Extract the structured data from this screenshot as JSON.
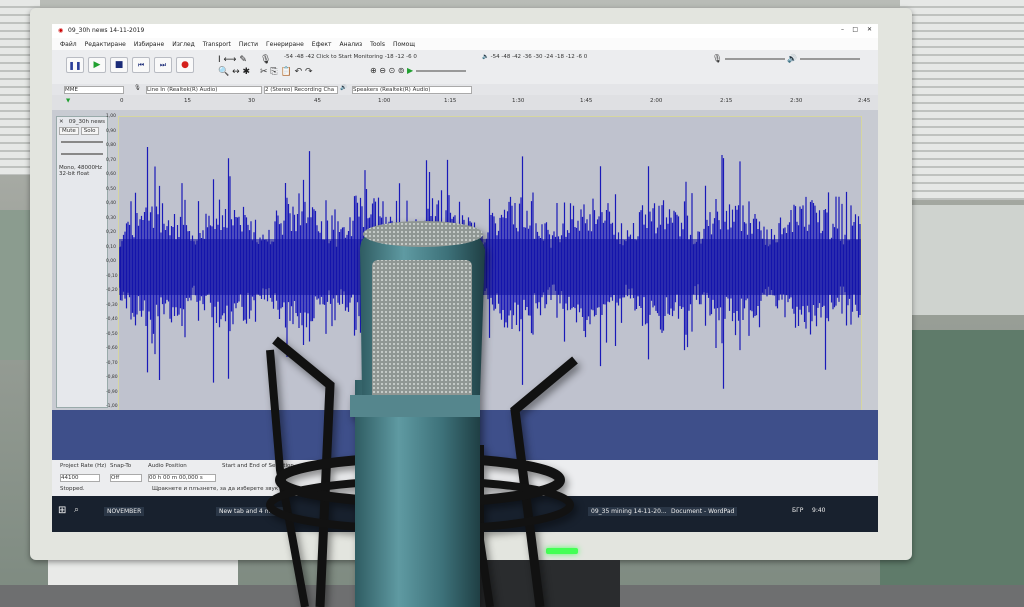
{
  "window": {
    "title": "09_30h news 14-11-2019",
    "menu": [
      "Файл",
      "Редактиране",
      "Избиране",
      "Изглед",
      "Transport",
      "Писти",
      "Генериране",
      "Ефект",
      "Анализ",
      "Tools",
      "Помощ"
    ]
  },
  "toolbar": {
    "meter_hint": "Click to Start Monitoring",
    "meter_ticks": [
      "-54",
      "-48",
      "-42",
      "-18",
      "-12",
      "-6",
      "0"
    ],
    "right_meter_ticks": [
      "-54",
      "-48",
      "-42",
      "-36",
      "-30",
      "-24",
      "-18",
      "-12",
      "-6",
      "0"
    ]
  },
  "devices": {
    "host": "MME",
    "input": "Line In (Realtek(R) Audio)",
    "channels": "2 (Stereo) Recording Cha",
    "output": "Speakers (Realtek(R) Audio)"
  },
  "timeline": {
    "ticks": [
      "0",
      "15",
      "30",
      "45",
      "1:00",
      "1:15",
      "1:30",
      "1:45",
      "2:00",
      "2:15",
      "2:30",
      "2:45"
    ]
  },
  "track": {
    "name": "09_30h news",
    "mute": "Mute",
    "solo": "Solo",
    "info_line1": "Mono, 48000Hz",
    "info_line2": "32-bit float",
    "amplitude_labels": [
      "1,00",
      "0,90",
      "0,80",
      "0,70",
      "0,60",
      "0,50",
      "0,40",
      "0,30",
      "0,20",
      "0,10",
      "0,00",
      "-0,10",
      "-0,20",
      "-0,30",
      "-0,40",
      "-0,50",
      "-0,60",
      "-0,70",
      "-0,80",
      "-0,90",
      "-1,00"
    ]
  },
  "selection_toolbar": {
    "project_rate_label": "Project Rate (Hz)",
    "project_rate": "44100",
    "snap_to_label": "Snap-To",
    "snap_to": "Off",
    "audio_position_label": "Audio Position",
    "audio_position": "00 h 00 m 00,000 s",
    "selection_label": "Start and End of Selection",
    "status": "Stopped.",
    "hint": "Щракнете и плъзнете, за да изберете звук"
  },
  "taskbar": {
    "items": [
      "NOVEMBER",
      "New tab and 4 more ...",
      "09_35 mining 14-11-20...",
      "Document - WordPad"
    ],
    "clock": "9:40",
    "lang": "БГР"
  },
  "colors": {
    "waveform": "#1a1ab8",
    "waveform_core": "#1010a0",
    "accent_green": "#2fd24a",
    "record_red": "#d4201c"
  }
}
